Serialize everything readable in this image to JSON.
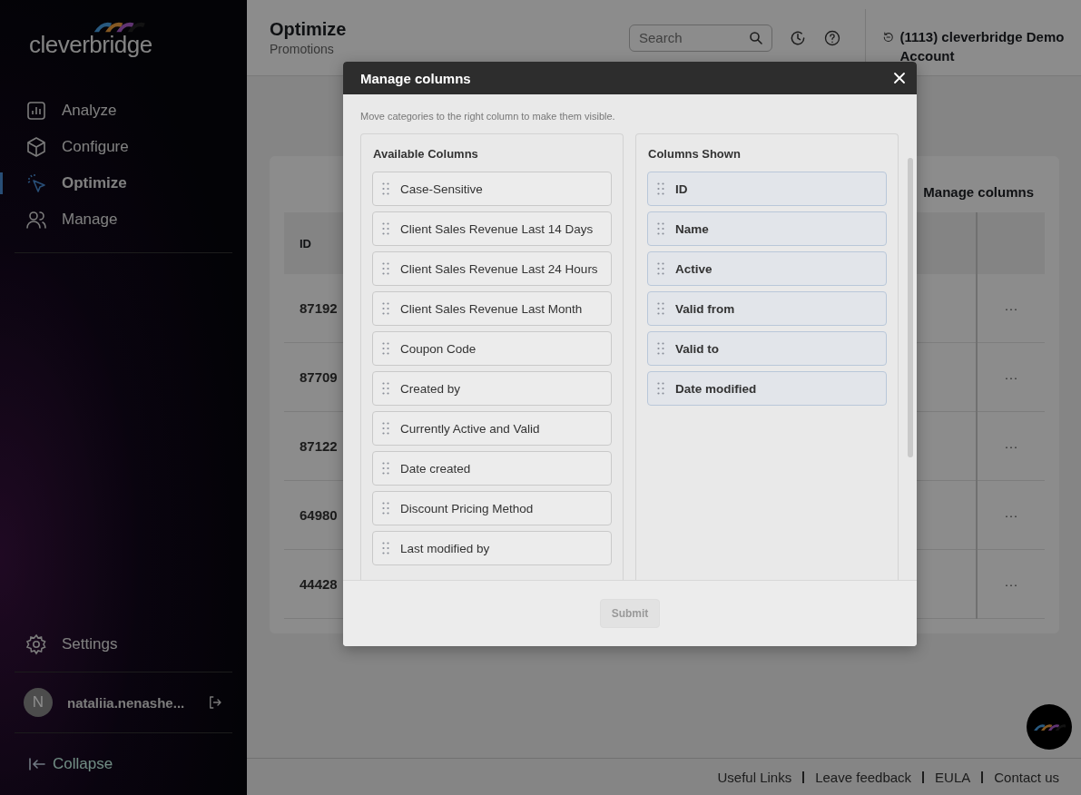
{
  "sidebar": {
    "logo": "cleverbridge",
    "nav": [
      {
        "label": "Analyze",
        "selected": false
      },
      {
        "label": "Configure",
        "selected": false
      },
      {
        "label": "Optimize",
        "selected": true
      },
      {
        "label": "Manage",
        "selected": false
      }
    ],
    "settings": "Settings",
    "user": {
      "initial": "N",
      "name": "nataliia.nenashe..."
    },
    "collapse": "Collapse"
  },
  "header": {
    "title": "Optimize",
    "subtitle": "Promotions",
    "search": {
      "placeholder": "Search"
    },
    "account": "(1113) cleverbridge Demo Account"
  },
  "card": {
    "manage_columns": "Manage columns",
    "table": {
      "columns": [
        "ID"
      ],
      "rows": [
        {
          "id": "87192",
          "action": "···"
        },
        {
          "id": "87709",
          "action": "···"
        },
        {
          "id": "87122",
          "action": "···"
        },
        {
          "id": "64980",
          "action": "···"
        },
        {
          "id": "44428",
          "action": "···"
        }
      ]
    }
  },
  "modal": {
    "title": "Manage columns",
    "hint": "Move categories to the right column to make them visible.",
    "available": {
      "title": "Available Columns",
      "items": [
        "Case-Sensitive",
        "Client Sales Revenue Last 14 Days",
        "Client Sales Revenue Last 24 Hours",
        "Client Sales Revenue Last Month",
        "Coupon Code",
        "Created by",
        "Currently Active and Valid",
        "Date created",
        "Discount Pricing Method",
        "Last modified by"
      ]
    },
    "shown": {
      "title": "Columns Shown",
      "items": [
        "ID",
        "Name",
        "Active",
        "Valid from",
        "Valid to",
        "Date modified"
      ]
    },
    "submit": {
      "label": "Submit",
      "disabled": true
    }
  },
  "footer": {
    "links": [
      "Useful Links",
      "Leave feedback",
      "EULA",
      "Contact us"
    ]
  }
}
